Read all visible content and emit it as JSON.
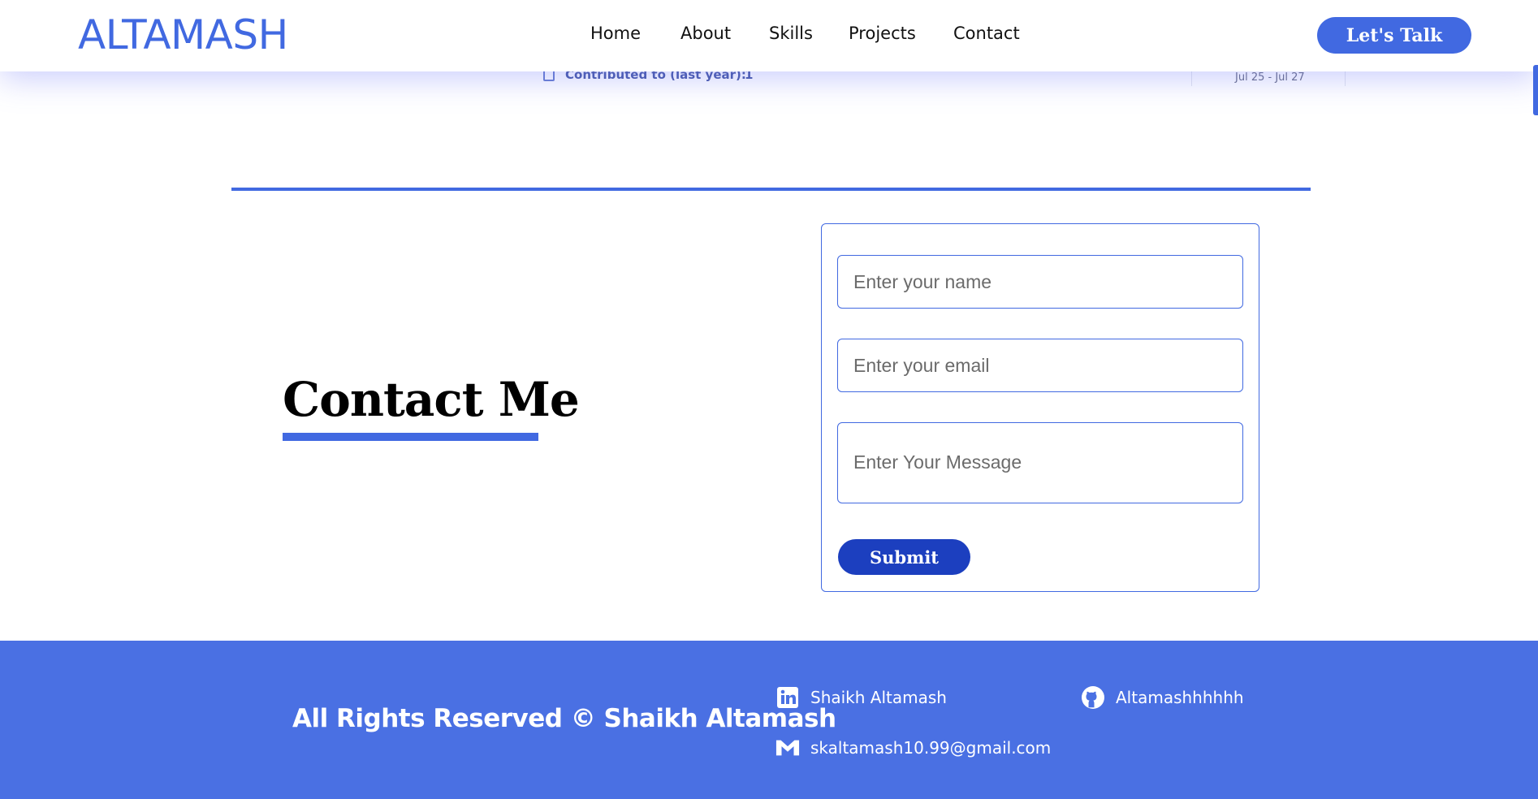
{
  "header": {
    "brand": "ALTAMASH",
    "nav": [
      "Home",
      "About",
      "Skills",
      "Projects",
      "Contact"
    ],
    "cta_label": "Let's Talk"
  },
  "peek": {
    "contributed_label": "Contributed to (last year):",
    "contributed_value": "1",
    "date_range": "Jul 25 - Jul 27"
  },
  "contact": {
    "title": "Contact Me",
    "form": {
      "name_placeholder": "Enter your name",
      "email_placeholder": "Enter your email",
      "message_placeholder": "Enter Your Message",
      "submit_label": "Submit"
    }
  },
  "footer": {
    "rights": "All Rights Reserved © Shaikh Altamash",
    "linkedin": "Shaikh Altamash",
    "github": "Altamashhhhhh",
    "email": "skaltamash10.99@gmail.com"
  },
  "colors": {
    "accent": "#4169e1",
    "footer_bg": "#4a70e3",
    "submit_bg": "#1c3fbf"
  },
  "icons": [
    "linkedin-icon",
    "github-icon",
    "mail-icon",
    "monitor-icon"
  ]
}
